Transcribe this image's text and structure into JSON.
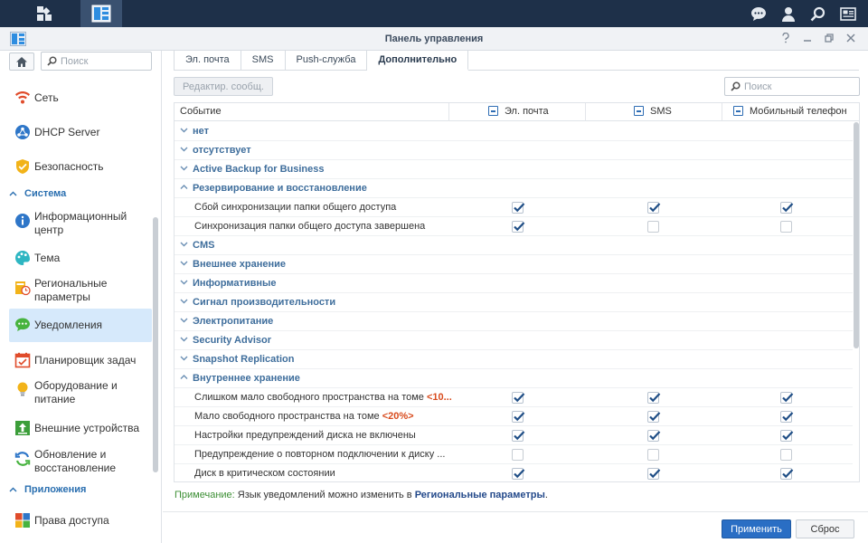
{
  "window": {
    "title": "Панель управления"
  },
  "sidebar": {
    "search_placeholder": "Поиск",
    "items": [
      {
        "label": "Сеть",
        "icon": "network-icon"
      },
      {
        "label": "DHCP Server",
        "icon": "dhcp-server-icon"
      },
      {
        "label": "Безопасность",
        "icon": "security-shield-icon"
      },
      {
        "group": "Система"
      },
      {
        "label": "Информационный центр",
        "icon": "info-center-icon"
      },
      {
        "label": "Тема",
        "icon": "theme-palette-icon"
      },
      {
        "label": "Региональные параметры",
        "icon": "regional-options-icon"
      },
      {
        "label": "Уведомления",
        "icon": "notification-icon",
        "selected": true
      },
      {
        "label": "Планировщик задач",
        "icon": "task-scheduler-icon"
      },
      {
        "label": "Оборудование и питание",
        "icon": "hardware-power-icon"
      },
      {
        "label": "Внешние устройства",
        "icon": "external-devices-icon"
      },
      {
        "label": "Обновление и восстановление",
        "icon": "update-restore-icon"
      },
      {
        "group": "Приложения"
      },
      {
        "label": "Права доступа",
        "icon": "application-privileges-icon"
      }
    ]
  },
  "tabs": [
    {
      "label": "Эл. почта"
    },
    {
      "label": "SMS"
    },
    {
      "label": "Push-служба"
    },
    {
      "label": "Дополнительно",
      "active": true
    }
  ],
  "toolbar": {
    "edit_label": "Редактир. сообщ.",
    "search_placeholder": "Поиск"
  },
  "grid": {
    "columns": {
      "event": "Событие",
      "email": "Эл. почта",
      "sms": "SMS",
      "mobile": "Мобильный телефон"
    },
    "rows": [
      {
        "type": "group",
        "label": "нет",
        "expanded": false
      },
      {
        "type": "group",
        "label": "отсутствует",
        "expanded": false
      },
      {
        "type": "group",
        "label": "Active Backup for Business",
        "expanded": false
      },
      {
        "type": "group",
        "label": "Резервирование и восстановление",
        "expanded": true
      },
      {
        "type": "item",
        "label": "Сбой синхронизации папки общего доступа",
        "email": true,
        "sms": true,
        "mobile": true
      },
      {
        "type": "item",
        "label": "Синхронизация папки общего доступа завершена",
        "email": true,
        "sms": false,
        "mobile": false
      },
      {
        "type": "group",
        "label": "CMS",
        "expanded": false
      },
      {
        "type": "group",
        "label": "Внешнее хранение",
        "expanded": false
      },
      {
        "type": "group",
        "label": "Информативные",
        "expanded": false
      },
      {
        "type": "group",
        "label": "Сигнал производительности",
        "expanded": false
      },
      {
        "type": "group",
        "label": "Электропитание",
        "expanded": false
      },
      {
        "type": "group",
        "label": "Security Advisor",
        "expanded": false
      },
      {
        "type": "group",
        "label": "Snapshot Replication",
        "expanded": false
      },
      {
        "type": "group",
        "label": "Внутреннее хранение",
        "expanded": true
      },
      {
        "type": "item",
        "label": "Слишком мало свободного пространства на томе ",
        "highlight": "<10...",
        "email": true,
        "sms": true,
        "mobile": true
      },
      {
        "type": "item",
        "label": "Мало свободного пространства на томе ",
        "highlight": "<20%>",
        "email": true,
        "sms": true,
        "mobile": true
      },
      {
        "type": "item",
        "label": "Настройки предупреждений диска не включены",
        "email": true,
        "sms": true,
        "mobile": true
      },
      {
        "type": "item",
        "label": "Предупреждение о повторном подключении к диску ...",
        "email": false,
        "sms": false,
        "mobile": false
      },
      {
        "type": "item",
        "label": "Диск в критическом состоянии",
        "email": true,
        "sms": true,
        "mobile": true
      }
    ]
  },
  "note": {
    "label": "Примечание:",
    "text": " Язык уведомлений можно изменить в ",
    "link": "Региональные параметры",
    "end": "."
  },
  "footer": {
    "apply_label": "Применить",
    "reset_label": "Сброс"
  },
  "colors": {
    "taskbar": "#1e3049",
    "accent": "#2a6ec4",
    "group_text": "#3f6e9c",
    "highlight": "#d84b1d",
    "selected_bg": "#d6e9fb"
  }
}
